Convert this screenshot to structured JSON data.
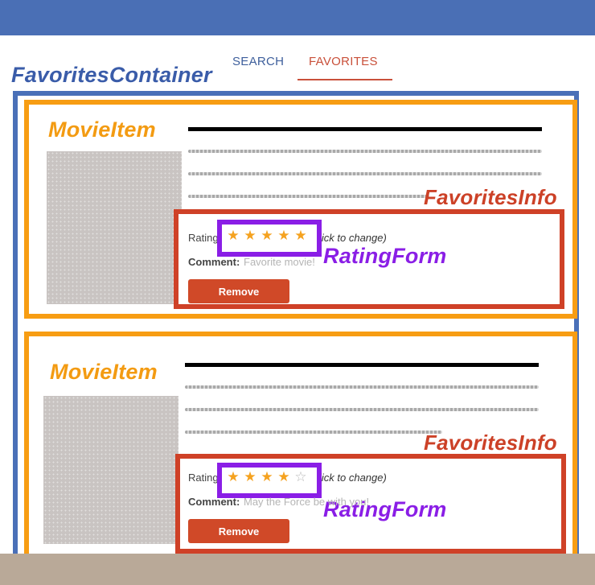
{
  "tabs": {
    "search": "SEARCH",
    "favorites": "FAVORITES"
  },
  "annotations": {
    "favorites_container": "FavoritesContainer",
    "movie_item": "MovieItem",
    "favorites_info": "FavoritesInfo",
    "rating_form": "RatingForm"
  },
  "movies": [
    {
      "rating_label": "Rating",
      "click_hint": "lick to change)",
      "rating": 5,
      "max_rating": 5,
      "comment_label": "Comment:",
      "comment_value": "Favorite movie!",
      "remove_label": "Remove"
    },
    {
      "rating_label": "Rating",
      "click_hint": "lick to change)",
      "rating": 4,
      "max_rating": 5,
      "comment_label": "Comment:",
      "comment_value": "May the Force be with you!",
      "remove_label": "Remove"
    }
  ],
  "colors": {
    "favorites_container": "#4a70b8",
    "movie_item": "#f79d13",
    "favorites_info": "#cf4127",
    "rating_form": "#8a1ee6",
    "star": "#f5a21f",
    "header": "#4a6fb5"
  }
}
